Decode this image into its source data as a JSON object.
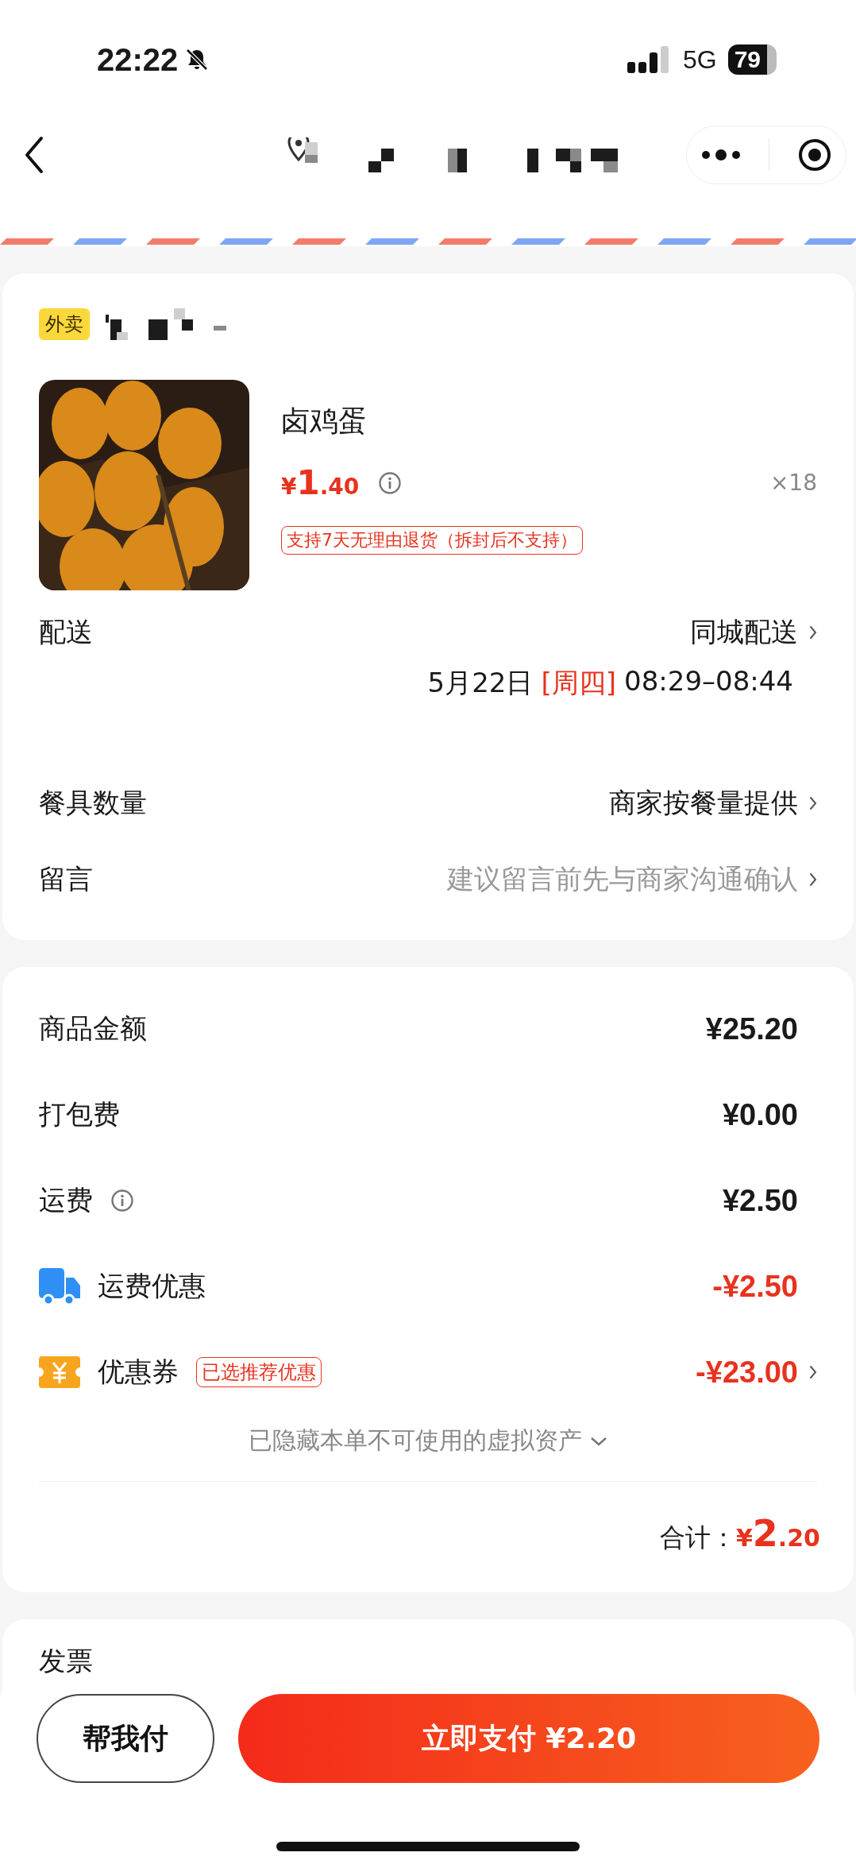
{
  "status_bar": {
    "time": "22:22",
    "network": "5G",
    "battery": "79"
  },
  "order": {
    "tag": "外卖",
    "product": {
      "kind": "picture",
      "name": "卤鸡蛋",
      "price": {
        "currency": "¥",
        "whole": "1",
        "fraction": ".40"
      },
      "quantity": "×18",
      "policy": "支持7天无理由退货（拆封后不支持）"
    },
    "delivery": {
      "label": "配送",
      "value": "同城配送",
      "date": "5月22日",
      "weekday": "[周四]",
      "time": "08:29–08:44"
    },
    "options": [
      {
        "label": "餐具数量",
        "value": "商家按餐量提供",
        "muted": false
      },
      {
        "label": "留言",
        "value": "建议留言前先与商家沟通确认",
        "muted": true
      }
    ]
  },
  "fees": {
    "rows": [
      {
        "kind": "plain",
        "label": "商品金额",
        "amount": "¥25.20",
        "discount": false,
        "chevron": false
      },
      {
        "kind": "plain",
        "label": "打包费",
        "amount": "¥0.00",
        "discount": false,
        "chevron": false
      },
      {
        "kind": "info",
        "label": "运费",
        "amount": "¥2.50",
        "discount": false,
        "chevron": false
      },
      {
        "kind": "truck",
        "label": "运费优惠",
        "amount": "-¥2.50",
        "discount": true,
        "chevron": false
      },
      {
        "kind": "coupon",
        "label": "优惠券",
        "badge": "已选推荐优惠",
        "amount": "-¥23.00",
        "discount": true,
        "chevron": true
      }
    ],
    "hidden_note": "已隐藏本单不可使用的虚拟资产",
    "total": {
      "label": "合计：",
      "currency": "¥",
      "whole": "2",
      "fraction": ".20"
    }
  },
  "invoice": {
    "label": "发票"
  },
  "buttons": [
    {
      "kind": "secondary",
      "label": "帮我付"
    },
    {
      "kind": "primary",
      "label": "立即支付 ¥2.20"
    }
  ]
}
